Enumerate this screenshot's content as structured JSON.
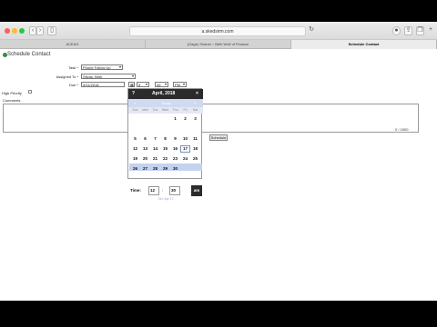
{
  "browser": {
    "url": "a.skedsirm.com",
    "tabs": [
      "ACEAG",
      "(Gage) Shanel :: Beth Wolf of Finance",
      "Schedule Contact"
    ],
    "active_tab": 2
  },
  "page": {
    "title": "Schedule Contact"
  },
  "form": {
    "task_label": "Task *",
    "task_value": "Phone Follow Up",
    "assigned_label": "Assigned To *",
    "assigned_value": "Sfivas, Beth",
    "due_label": "Due *",
    "due_date": "4/11/2018",
    "due_hour": "8",
    "due_minute": "45",
    "due_ampm": "PM",
    "priority_label": "High Priority",
    "comments_label": "Comments",
    "counter": "0 / 1500",
    "schedule_button": "Schedule"
  },
  "calendar": {
    "prev_label": "?",
    "month_title": "April, 2018",
    "close_label": "×",
    "year_row": [
      "«",
      "‹",
      "Today",
      "›",
      "»"
    ],
    "weekdays": [
      "Sun",
      "Mon",
      "Tue",
      "Wed",
      "Thu",
      "Fri",
      "Sat"
    ],
    "weeks": [
      [
        "",
        "",
        "",
        "",
        "1",
        "2",
        "3"
      ],
      [
        "",
        "",
        "",
        "",
        "",
        "",
        ""
      ],
      [
        "5",
        "6",
        "7",
        "8",
        "9",
        "10",
        "11"
      ],
      [
        "12",
        "13",
        "14",
        "15",
        "16",
        "17",
        "18"
      ],
      [
        "19",
        "20",
        "21",
        "22",
        "23",
        "24",
        "25"
      ],
      [
        "26",
        "27",
        "28",
        "29",
        "30",
        "",
        ""
      ]
    ],
    "selected_day": "20",
    "today_day": "17",
    "time_label": "Time:",
    "time_hour": "12",
    "time_sep": ":",
    "time_minute": "30",
    "time_ampm": "am",
    "footer": "Sel. Apr 17"
  },
  "colors": {
    "calendar_header": "#2b2b2b",
    "week_highlight": "#c3d2ee",
    "title_icon": "#3a8a4a"
  }
}
